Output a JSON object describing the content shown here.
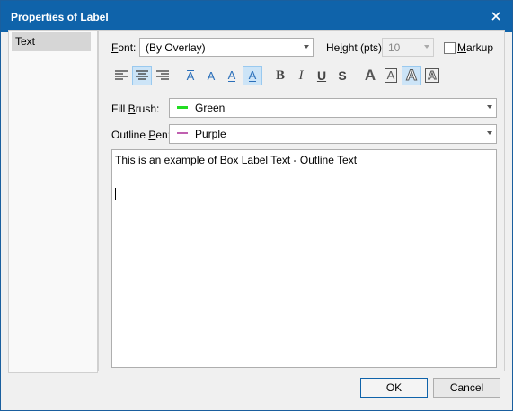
{
  "window": {
    "title": "Properties of Label"
  },
  "sidebar": {
    "items": [
      {
        "label": "Text"
      }
    ]
  },
  "font": {
    "label_u": "F",
    "label_rest": "ont:",
    "value": "(By Overlay)"
  },
  "height": {
    "label_pre": "He",
    "label_u": "i",
    "label_rest": "ght (pts):",
    "value": "10"
  },
  "markup": {
    "label_u": "M",
    "label_rest": "arkup",
    "checked": false
  },
  "toolbar": {
    "align": [
      "align-left",
      "align-center",
      "align-right"
    ],
    "textpos_glyphs": [
      "A",
      "A",
      "A",
      "A"
    ],
    "bold": "B",
    "italic": "I",
    "underline": "U",
    "strike": "S",
    "styles": [
      "A",
      "A",
      "A",
      "A"
    ]
  },
  "fill": {
    "label_pre": "Fill ",
    "label_u": "B",
    "label_rest": "rush:",
    "value": "Green",
    "color": "#22dd22"
  },
  "outline": {
    "label_pre": "Outline ",
    "label_u": "P",
    "label_rest": "en:",
    "value": "Purple",
    "color": "#c060b0"
  },
  "content": {
    "text": "This is an example of Box Label Text - Outline Text"
  },
  "buttons": {
    "ok": "OK",
    "cancel": "Cancel"
  }
}
